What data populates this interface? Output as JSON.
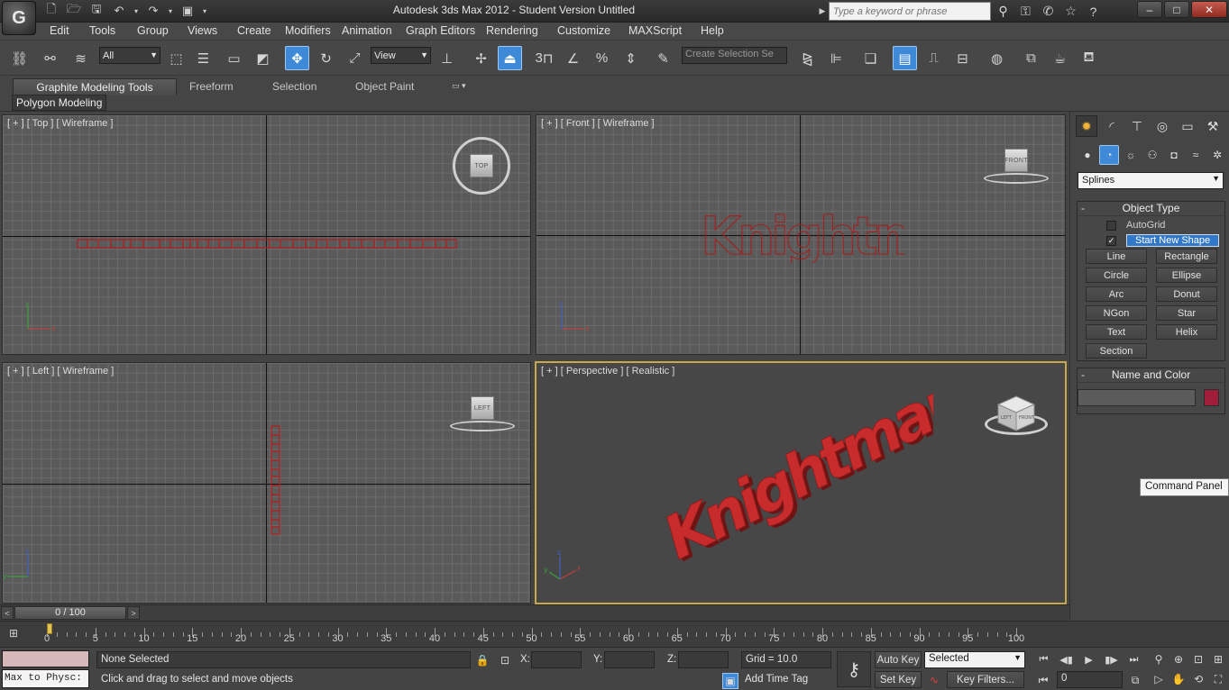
{
  "app": {
    "title": "Autodesk 3ds Max 2012  - Student Version   Untitled",
    "logo_letter": "G"
  },
  "search": {
    "placeholder": "Type a keyword or phrase"
  },
  "window_controls": {
    "minimize": "–",
    "maximize": "□",
    "close": "✕"
  },
  "menu": [
    "Edit",
    "Tools",
    "Group",
    "Views",
    "Create",
    "Modifiers",
    "Animation",
    "Graph Editors",
    "Rendering",
    "Customize",
    "MAXScript",
    "Help"
  ],
  "toolbar": {
    "selection_filter": "All",
    "reference_coord": "View",
    "selection_set_placeholder": "Create Selection Se",
    "snap_3d": "3"
  },
  "ribbon": {
    "tabs": [
      "Graphite Modeling Tools",
      "Freeform",
      "Selection",
      "Object Paint"
    ],
    "active_panel": "Polygon Modeling"
  },
  "viewports": {
    "top": {
      "label": "[ + ] [ Top ] [ Wireframe ]",
      "cube": "TOP"
    },
    "front": {
      "label": "[ + ] [ Front ] [ Wireframe ]",
      "cube": "FRONT"
    },
    "left": {
      "label": "[ + ] [ Left ] [ Wireframe ]",
      "cube": "LEFT"
    },
    "persp": {
      "label": "[ + ] [ Perspective ] [ Realistic ]",
      "cube_left": "LEFT",
      "cube_right": "FRONT"
    },
    "scene_text": "KnightmarE",
    "axis_labels": {
      "x": "x",
      "y": "y",
      "z": "z"
    }
  },
  "command_panel": {
    "category": "Splines",
    "object_type": {
      "title": "Object Type",
      "autogrid": "AutoGrid",
      "start_new_shape": "Start New Shape",
      "buttons": [
        "Line",
        "Rectangle",
        "Circle",
        "Ellipse",
        "Arc",
        "Donut",
        "NGon",
        "Star",
        "Text",
        "Helix",
        "Section"
      ]
    },
    "name_and_color": {
      "title": "Name and Color",
      "color": "#a01e39"
    },
    "tooltip": "Command Panel"
  },
  "timeline": {
    "frame_display": "0 / 100",
    "ticks": [
      "0",
      "5",
      "10",
      "15",
      "20",
      "25",
      "30",
      "35",
      "40",
      "45",
      "50",
      "55",
      "60",
      "65",
      "70",
      "75",
      "80",
      "85",
      "90",
      "95",
      "100"
    ],
    "prev": "<",
    "next": ">"
  },
  "status": {
    "listener": "Max to Physc:",
    "selection": "None Selected",
    "prompt": "Click and drag to select and move objects",
    "x_label": "X:",
    "y_label": "Y:",
    "z_label": "Z:",
    "grid": "Grid = 10.0",
    "add_time_tag": "Add Time Tag",
    "auto_key": "Auto Key",
    "set_key": "Set Key",
    "key_mode": "Selected",
    "key_filters": "Key Filters...",
    "current_frame": "0"
  },
  "colors": {
    "accent": "#3f8ad8",
    "active_viewport": "#c7a84d",
    "scene_object": "#a01e39"
  }
}
